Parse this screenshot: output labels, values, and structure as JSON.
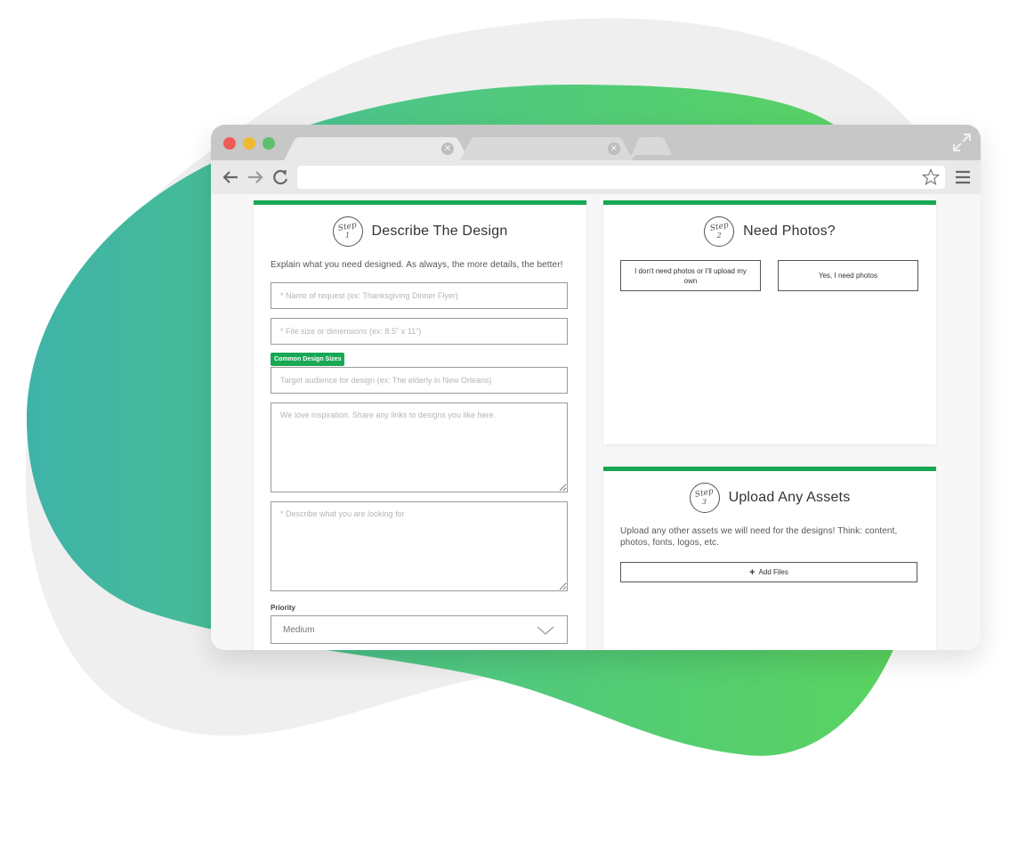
{
  "browser": {
    "tabs": [
      {
        "label": "",
        "close_glyph": "×"
      },
      {
        "label": "",
        "close_glyph": "×"
      }
    ],
    "icons": [
      "back-arrow-icon",
      "forward-arrow-icon",
      "reload-icon",
      "star-icon",
      "hamburger-menu-icon",
      "expand-icon"
    ],
    "url": ""
  },
  "step1": {
    "step_word": "Step",
    "step_number": "1",
    "title": "Describe The Design",
    "intro": "Explain what you need designed. As always, the more details, the better!",
    "fields": {
      "name_placeholder": "* Name of request (ex: Thanksgiving Dinner Flyer)",
      "size_placeholder": "* File size or dimensions (ex: 8.5\" x 11\")",
      "audience_placeholder": "Target audience for design (ex: The elderly in New Orleans)",
      "inspiration_placeholder": "We love inspiration. Share any links to designs you like here.",
      "describe_placeholder": "* Describe what you are looking for"
    },
    "common_sizes_badge": "Common Design Sizes",
    "priority_label": "Priority",
    "priority_value": "Medium"
  },
  "step2": {
    "step_word": "Step",
    "step_number": "2",
    "title": "Need Photos?",
    "option_no": "I don't need photos or I'll upload my own",
    "option_yes": "Yes, I need photos"
  },
  "step3": {
    "step_word": "Step",
    "step_number": "3",
    "title": "Upload Any Assets",
    "intro": "Upload any other assets we will need for the designs! Think: content, photos, fonts, logos, etc.",
    "add_files_label": "Add Files",
    "add_files_glyph": "+"
  },
  "colors": {
    "accent_green": "#18a853",
    "blob_green_start": "#3fb3a8",
    "blob_green_end": "#5ad45e",
    "blob_grey": "#efefef"
  }
}
